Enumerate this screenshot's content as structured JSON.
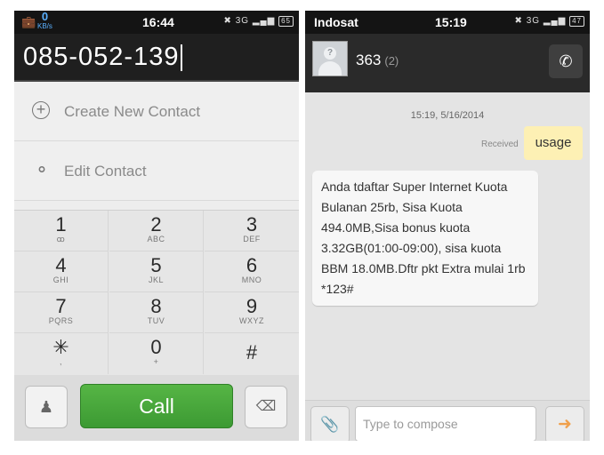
{
  "dialer": {
    "statusbar": {
      "time": "16:44",
      "speed_value": "0",
      "speed_unit": "KB/s",
      "network": "3G",
      "battery": "65"
    },
    "number": "085-052-139",
    "options": [
      {
        "label": "Create New Contact",
        "icon": "plus-circle-icon"
      },
      {
        "label": "Edit Contact",
        "icon": "edit-contact-icon"
      }
    ],
    "keys": [
      {
        "num": "1",
        "sub": "ꝏ"
      },
      {
        "num": "2",
        "sub": "ABC"
      },
      {
        "num": "3",
        "sub": "DEF"
      },
      {
        "num": "4",
        "sub": "GHI"
      },
      {
        "num": "5",
        "sub": "JKL"
      },
      {
        "num": "6",
        "sub": "MNO"
      },
      {
        "num": "7",
        "sub": "PQRS"
      },
      {
        "num": "8",
        "sub": "TUV"
      },
      {
        "num": "9",
        "sub": "WXYZ"
      },
      {
        "num": "✳",
        "sub": ","
      },
      {
        "num": "0",
        "sub": "+"
      },
      {
        "num": "#",
        "sub": ""
      }
    ],
    "call_label": "Call"
  },
  "messaging": {
    "statusbar": {
      "carrier": "Indosat",
      "time": "15:19",
      "network": "3G",
      "battery": "47"
    },
    "contact_name": "363",
    "message_count": "(2)",
    "timestamp": "15:19, 5/16/2014",
    "received_label": "Received",
    "sent_message": "usage",
    "received_message": "Anda tdaftar Super Internet Kuota Bulanan 25rb, Sisa Kuota 494.0MB,Sisa bonus kuota 3.32GB(01:00-09:00), sisa kuota BBM 18.0MB.Dftr pkt Extra mulai 1rb *123#",
    "compose_placeholder": "Type to compose"
  }
}
